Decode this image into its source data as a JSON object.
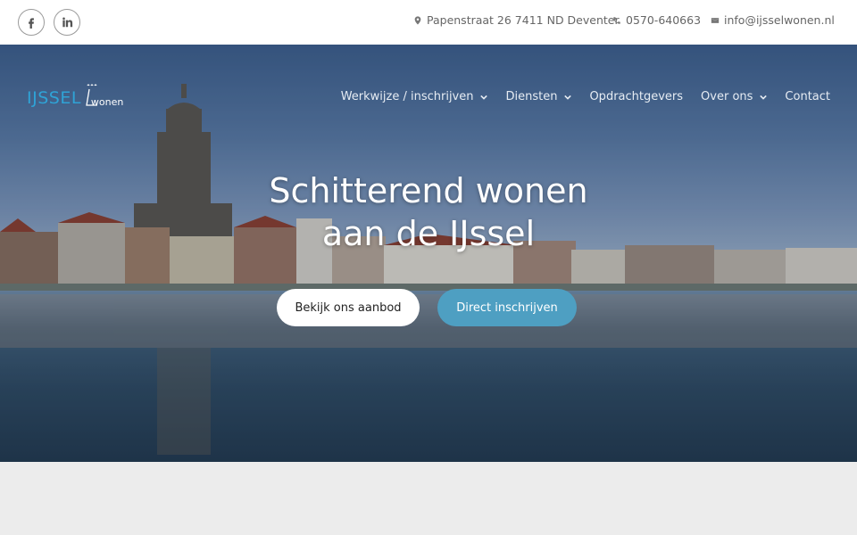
{
  "topbar": {
    "social": [
      {
        "icon": "facebook-icon"
      },
      {
        "icon": "linkedin-icon"
      }
    ],
    "address": "Papenstraat 26 7411 ND Deventer",
    "phone": "0570-640663",
    "email": "info@ijsselwonen.nl"
  },
  "logo": {
    "primary": "IJSSEL",
    "secondary": "wonen"
  },
  "nav": {
    "items": [
      {
        "label": "Werkwijze / inschrijven",
        "has_dropdown": true
      },
      {
        "label": "Diensten",
        "has_dropdown": true
      },
      {
        "label": "Opdrachtgevers",
        "has_dropdown": false
      },
      {
        "label": "Over ons",
        "has_dropdown": true
      },
      {
        "label": "Contact",
        "has_dropdown": false
      }
    ]
  },
  "hero": {
    "headline_line1": "Schitterend wonen",
    "headline_line2": "aan de IJssel",
    "button_primary": "Bekijk ons aanbod",
    "button_secondary": "Direct inschrijven"
  },
  "colors": {
    "accent_blue": "#4e9fc2",
    "logo_blue": "#2fa3d6",
    "page_bg": "#ececec"
  }
}
